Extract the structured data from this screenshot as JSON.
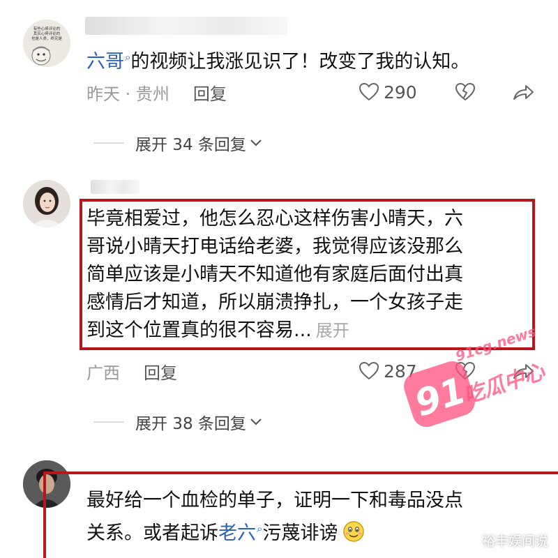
{
  "comments": [
    {
      "mention": "六哥",
      "text_after_mention": "的视频让我涨见识了！改变了我的认知。",
      "location": "昨天 · 贵州",
      "reply_label": "回复",
      "likes": "290",
      "expand_label": "展开 34 条回复",
      "avatar_text": "有些心疼评论的\n其实心疼评论的\n也是人类，终究是\n人……"
    },
    {
      "lines": [
        "毕竟相爱过，他怎么忍心这样伤害小晴天，六",
        "哥说小晴天打电话给老婆，我觉得应该没那么",
        "简单应该是小晴天不知道他有家庭后面付出真",
        "感情后才知道，所以崩溃挣扎，一个女孩子走",
        "到这个位置真的很不容易..."
      ],
      "more_label": "展开",
      "location": "广西",
      "reply_label": "回复",
      "likes": "287",
      "expand_label": "展开 38 条回复"
    },
    {
      "line1": "最好给一个血检的单子，证明一下和毒品没点",
      "line2_before": "关系。或者起诉",
      "mention": "老六",
      "line2_after": "污蔑诽谤"
    }
  ],
  "icons": {
    "like": "heart-outline-icon",
    "dislike": "broken-heart-icon",
    "share": "share-arrow-icon",
    "chevron": "chevron-down-icon",
    "mention": "search-magnifier-icon",
    "emoji": "smiling-face-emoji-icon"
  },
  "watermark": {
    "number": "91",
    "site": "91cg.news",
    "brand": "吃瓜中心",
    "corner": "裕丰娱间说"
  },
  "colors": {
    "highlight_box": "#b8161b",
    "mention": "#2a62b8",
    "watermark": "#ff3c6e"
  }
}
